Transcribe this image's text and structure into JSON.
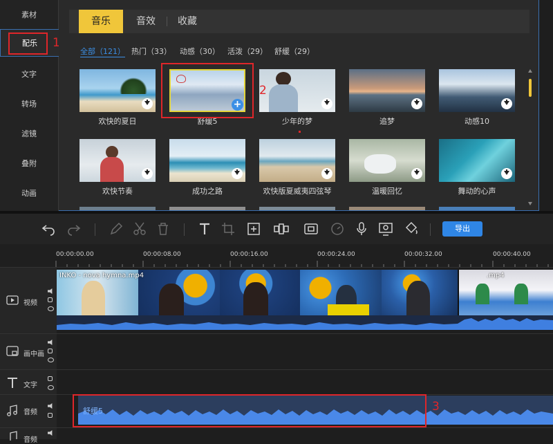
{
  "sidebar": {
    "items": [
      {
        "label": "素材"
      },
      {
        "label": "配乐"
      },
      {
        "label": "文字"
      },
      {
        "label": "转场"
      },
      {
        "label": "滤镜"
      },
      {
        "label": "叠附"
      },
      {
        "label": "动画"
      }
    ]
  },
  "annotations": [
    "1",
    "2",
    "3"
  ],
  "tabs": [
    {
      "label": "音乐",
      "active": true
    },
    {
      "label": "音效"
    },
    {
      "label": "收藏"
    }
  ],
  "filters": [
    {
      "label": "全部（121）",
      "active": true
    },
    {
      "label": "热门（33）"
    },
    {
      "label": "动感（30）"
    },
    {
      "label": "活泼（29）"
    },
    {
      "label": "舒缓（29）"
    }
  ],
  "music_items": [
    {
      "title": "欢快的夏日"
    },
    {
      "title": "舒缓5",
      "selected": true
    },
    {
      "title": "少年的梦"
    },
    {
      "title": "追梦"
    },
    {
      "title": "动感10"
    },
    {
      "title": "欢快节奏"
    },
    {
      "title": "成功之路"
    },
    {
      "title": "欢快版夏威夷四弦琴"
    },
    {
      "title": "温暖回忆"
    },
    {
      "title": "舞动的心声"
    }
  ],
  "toolbar": {
    "icons": [
      "undo-icon",
      "redo-icon",
      "pencil-icon",
      "scissors-icon",
      "trash-icon",
      "text-icon",
      "crop-icon",
      "zoom-frame-icon",
      "mosaic-icon",
      "pip-icon",
      "speed-icon",
      "mic-icon",
      "screen-record-icon",
      "paint-bucket-icon"
    ],
    "export_label": "导出"
  },
  "ruler": {
    "ticks": [
      "00:00:00.00",
      "00:00:08.00",
      "00:00:16.00",
      "00:00:24.00",
      "00:00:32.00",
      "00:00:40.00"
    ]
  },
  "tracks": {
    "video": {
      "label": "视频",
      "clip1": "INKO - nova hymna.mp4",
      "clip2": ".mp4"
    },
    "pip": {
      "label": "画中画"
    },
    "text": {
      "label": "文字"
    },
    "audio": {
      "label": "音频",
      "clip": "舒缓5"
    },
    "audio2": {
      "label": "音频"
    }
  },
  "colors": {
    "accent": "#f0c63a",
    "blue": "#2f86e6",
    "annotation_red": "#e0262a",
    "video_clip_bg": "#2d3a55",
    "audio_wave": "#4a88e8"
  }
}
